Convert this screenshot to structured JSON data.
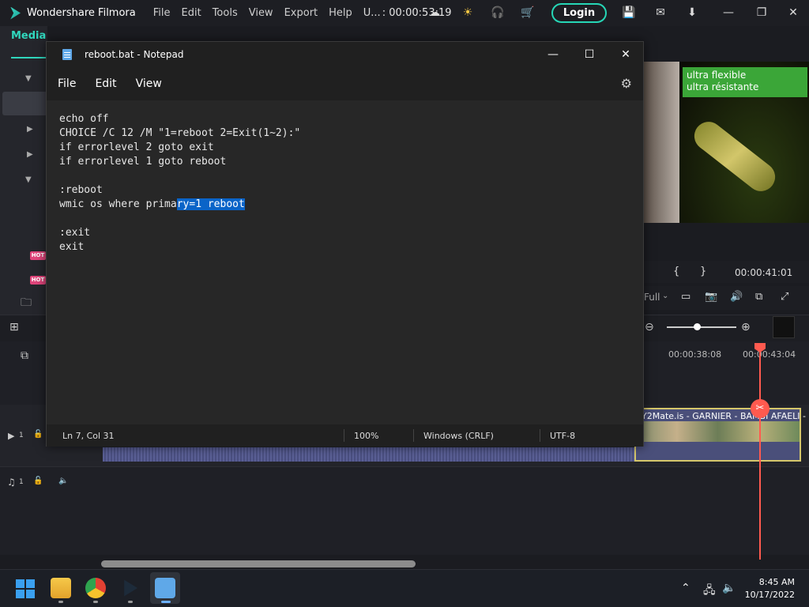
{
  "filmora": {
    "app_name": "Wondershare Filmora",
    "menu": [
      "File",
      "Edit",
      "Tools",
      "View",
      "Export",
      "Help"
    ],
    "project_name": "U...",
    "timecode": ": 00:00:53:19",
    "login_label": "Login",
    "media_tab": "Media",
    "library_hot": "HOT",
    "preview_banner_line1": "ultra flexible",
    "preview_banner_line2": "ultra résistante",
    "preview_time": "00:00:41:01",
    "preview_quality": "Full",
    "ruler_labels": [
      "00:00:38:08",
      "00:00:43:04"
    ],
    "track_video_num": "1",
    "track_audio_num": "1",
    "clip_label": "Y2Mate.is - GARNIER  - BAMBI AFAELI -"
  },
  "notepad": {
    "title": "reboot.bat - Notepad",
    "menu": [
      "File",
      "Edit",
      "View"
    ],
    "code_lines": [
      "echo off",
      "CHOICE /C 12 /M \"1=reboot 2=Exit(1~2):\"",
      "if errorlevel 2 goto exit",
      "if errorlevel 1 goto reboot",
      "",
      ":reboot",
      "",
      "",
      ":exit",
      "exit"
    ],
    "line7_unselected": "wmic os where prima",
    "line7_selected": "ry=1 reboot",
    "status_position": "Ln 7, Col 31",
    "status_zoom": "100%",
    "status_line_ending": "Windows (CRLF)",
    "status_encoding": "UTF-8"
  },
  "taskbar": {
    "time": "8:45 AM",
    "date": "10/17/2022"
  },
  "colors": {
    "filmora_accent": "#30d7bd",
    "selection": "#0a64c8",
    "playhead": "#ff5a4f"
  }
}
